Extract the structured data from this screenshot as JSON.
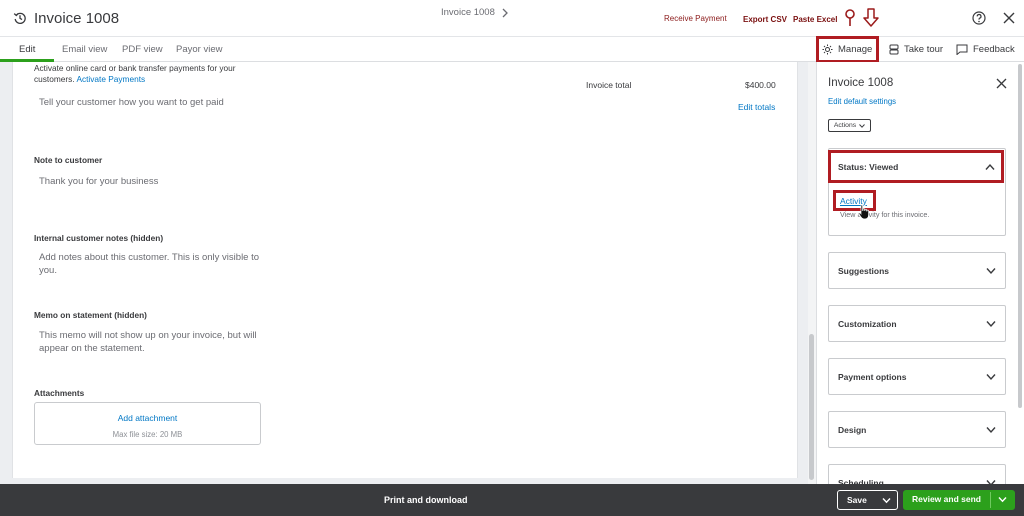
{
  "header": {
    "title": "Invoice 1008",
    "receive_payment": "Receive Payment",
    "export_csv": "Export CSV",
    "paste_excel": "Paste Excel"
  },
  "tabs": [
    {
      "label": "Edit",
      "active": true
    },
    {
      "label": "Email view"
    },
    {
      "label": "PDF view"
    },
    {
      "label": "Payor view"
    }
  ],
  "breadcrumb": {
    "label": "Invoice 1008"
  },
  "toolbar": {
    "manage": "Manage",
    "take_tour": "Take tour",
    "feedback": "Feedback"
  },
  "main": {
    "payments_text": "Activate online card or bank transfer payments for your customers.",
    "payments_link": "Activate Payments",
    "paid_prompt": "Tell your customer how you want to get paid",
    "invoice_total_label": "Invoice total",
    "invoice_total_value": "$400.00",
    "edit_totals": "Edit totals",
    "note_label": "Note to customer",
    "note_text": "Thank you for your business",
    "internal_label": "Internal customer notes (hidden)",
    "internal_text": "Add notes about this customer. This is only visible to you.",
    "memo_label": "Memo on statement (hidden)",
    "memo_text": "This memo will not show up on your invoice, but will appear on the statement.",
    "attachments_label": "Attachments",
    "add_attachment": "Add attachment",
    "max_file_size": "Max file size: 20 MB"
  },
  "panel": {
    "title": "Invoice 1008",
    "edit_default_settings": "Edit default settings",
    "actions": "Actions",
    "status": {
      "label": "Status: Viewed",
      "activity_link": "Activity",
      "activity_desc": "View activity for this invoice."
    },
    "sections": [
      {
        "label": "Suggestions"
      },
      {
        "label": "Customization"
      },
      {
        "label": "Payment options"
      },
      {
        "label": "Design"
      },
      {
        "label": "Scheduling"
      }
    ]
  },
  "footer": {
    "print_download": "Print and download",
    "save": "Save",
    "review_send": "Review and send"
  },
  "colors": {
    "brand_green": "#2ca01c",
    "link_blue": "#0077c5",
    "highlight_red": "#b01c22",
    "footer_bg": "#393a3d"
  }
}
